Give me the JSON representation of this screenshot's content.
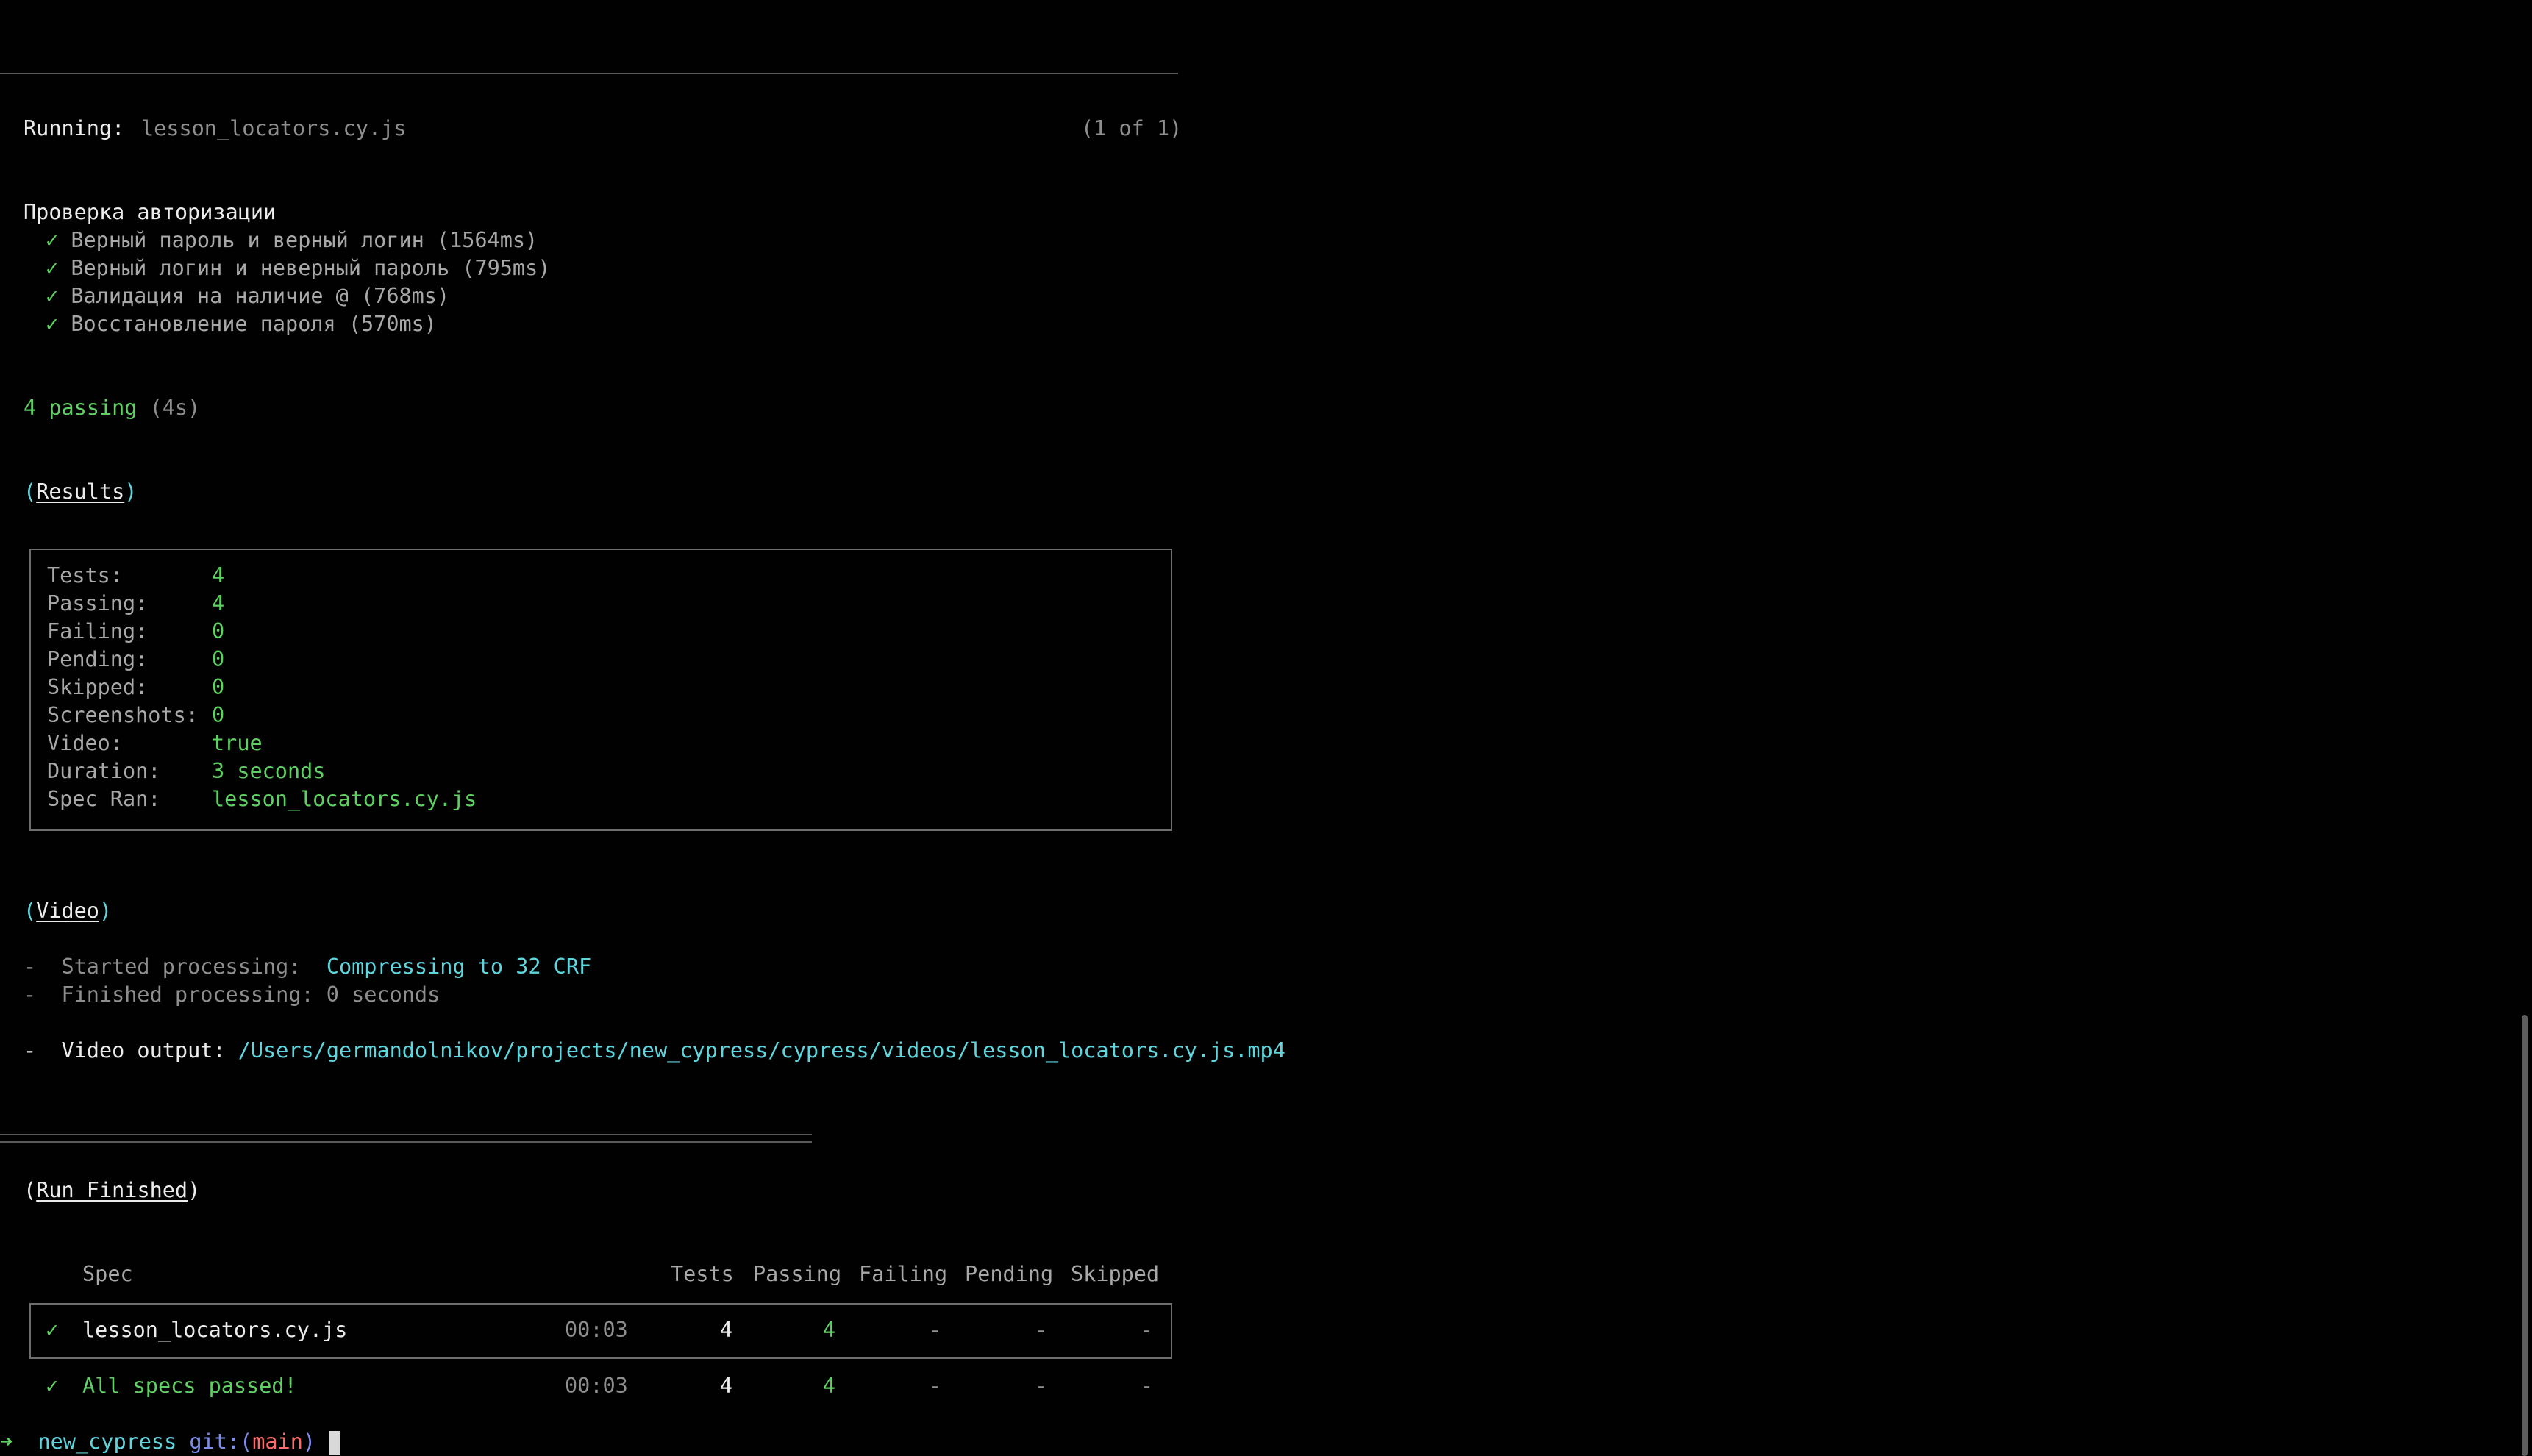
{
  "run": {
    "label": "Running:",
    "spec": "lesson_locators.cy.js",
    "counter": "(1 of 1)"
  },
  "suite": {
    "title": "Проверка авторизации",
    "tests": [
      {
        "mark": "✓",
        "name": "Верный пароль и верный логин",
        "time": "(1564ms)"
      },
      {
        "mark": "✓",
        "name": "Верный логин и неверный пароль",
        "time": "(795ms)"
      },
      {
        "mark": "✓",
        "name": "Валидация на наличие @",
        "time": "(768ms)"
      },
      {
        "mark": "✓",
        "name": "Восстановление пароля",
        "time": "(570ms)"
      }
    ]
  },
  "summary": {
    "passing": "4 passing",
    "duration": "(4s)"
  },
  "results": {
    "heading": "Results",
    "rows": [
      {
        "label": "Tests:",
        "value": "4"
      },
      {
        "label": "Passing:",
        "value": "4"
      },
      {
        "label": "Failing:",
        "value": "0"
      },
      {
        "label": "Pending:",
        "value": "0"
      },
      {
        "label": "Skipped:",
        "value": "0"
      },
      {
        "label": "Screenshots:",
        "value": "0"
      },
      {
        "label": "Video:",
        "value": "true"
      },
      {
        "label": "Duration:",
        "value": "3 seconds"
      },
      {
        "label": "Spec Ran:",
        "value": "lesson_locators.cy.js"
      }
    ]
  },
  "video": {
    "heading": "Video",
    "started_label": "Started processing:",
    "started_value": "Compressing to 32 CRF",
    "finished": "Finished processing: 0 seconds",
    "output_label": "Video output:",
    "output_path": "/Users/germandolnikov/projects/new_cypress/cypress/videos/lesson_locators.cy.js.mp4"
  },
  "run_finished": {
    "heading": "Run Finished",
    "columns": {
      "spec": "Spec",
      "tests": "Tests",
      "passing": "Passing",
      "failing": "Failing",
      "pending": "Pending",
      "skipped": "Skipped"
    },
    "spec_row": {
      "mark": "✓",
      "spec": "lesson_locators.cy.js",
      "duration": "00:03",
      "tests": "4",
      "passing": "4",
      "failing": "-",
      "pending": "-",
      "skipped": "-"
    },
    "total_row": {
      "mark": "✓",
      "spec": "All specs passed!",
      "duration": "00:03",
      "tests": "4",
      "passing": "4",
      "failing": "-",
      "pending": "-",
      "skipped": "-"
    }
  },
  "prompt": {
    "arrow": "➜",
    "dir": "new_cypress",
    "git_label": "git:(",
    "branch": "main",
    "git_close": ")",
    "dirty": "✗"
  },
  "colors": {
    "background": "#010101",
    "pass_green": "#5fd163",
    "info_cyan": "#5fd6dd"
  }
}
